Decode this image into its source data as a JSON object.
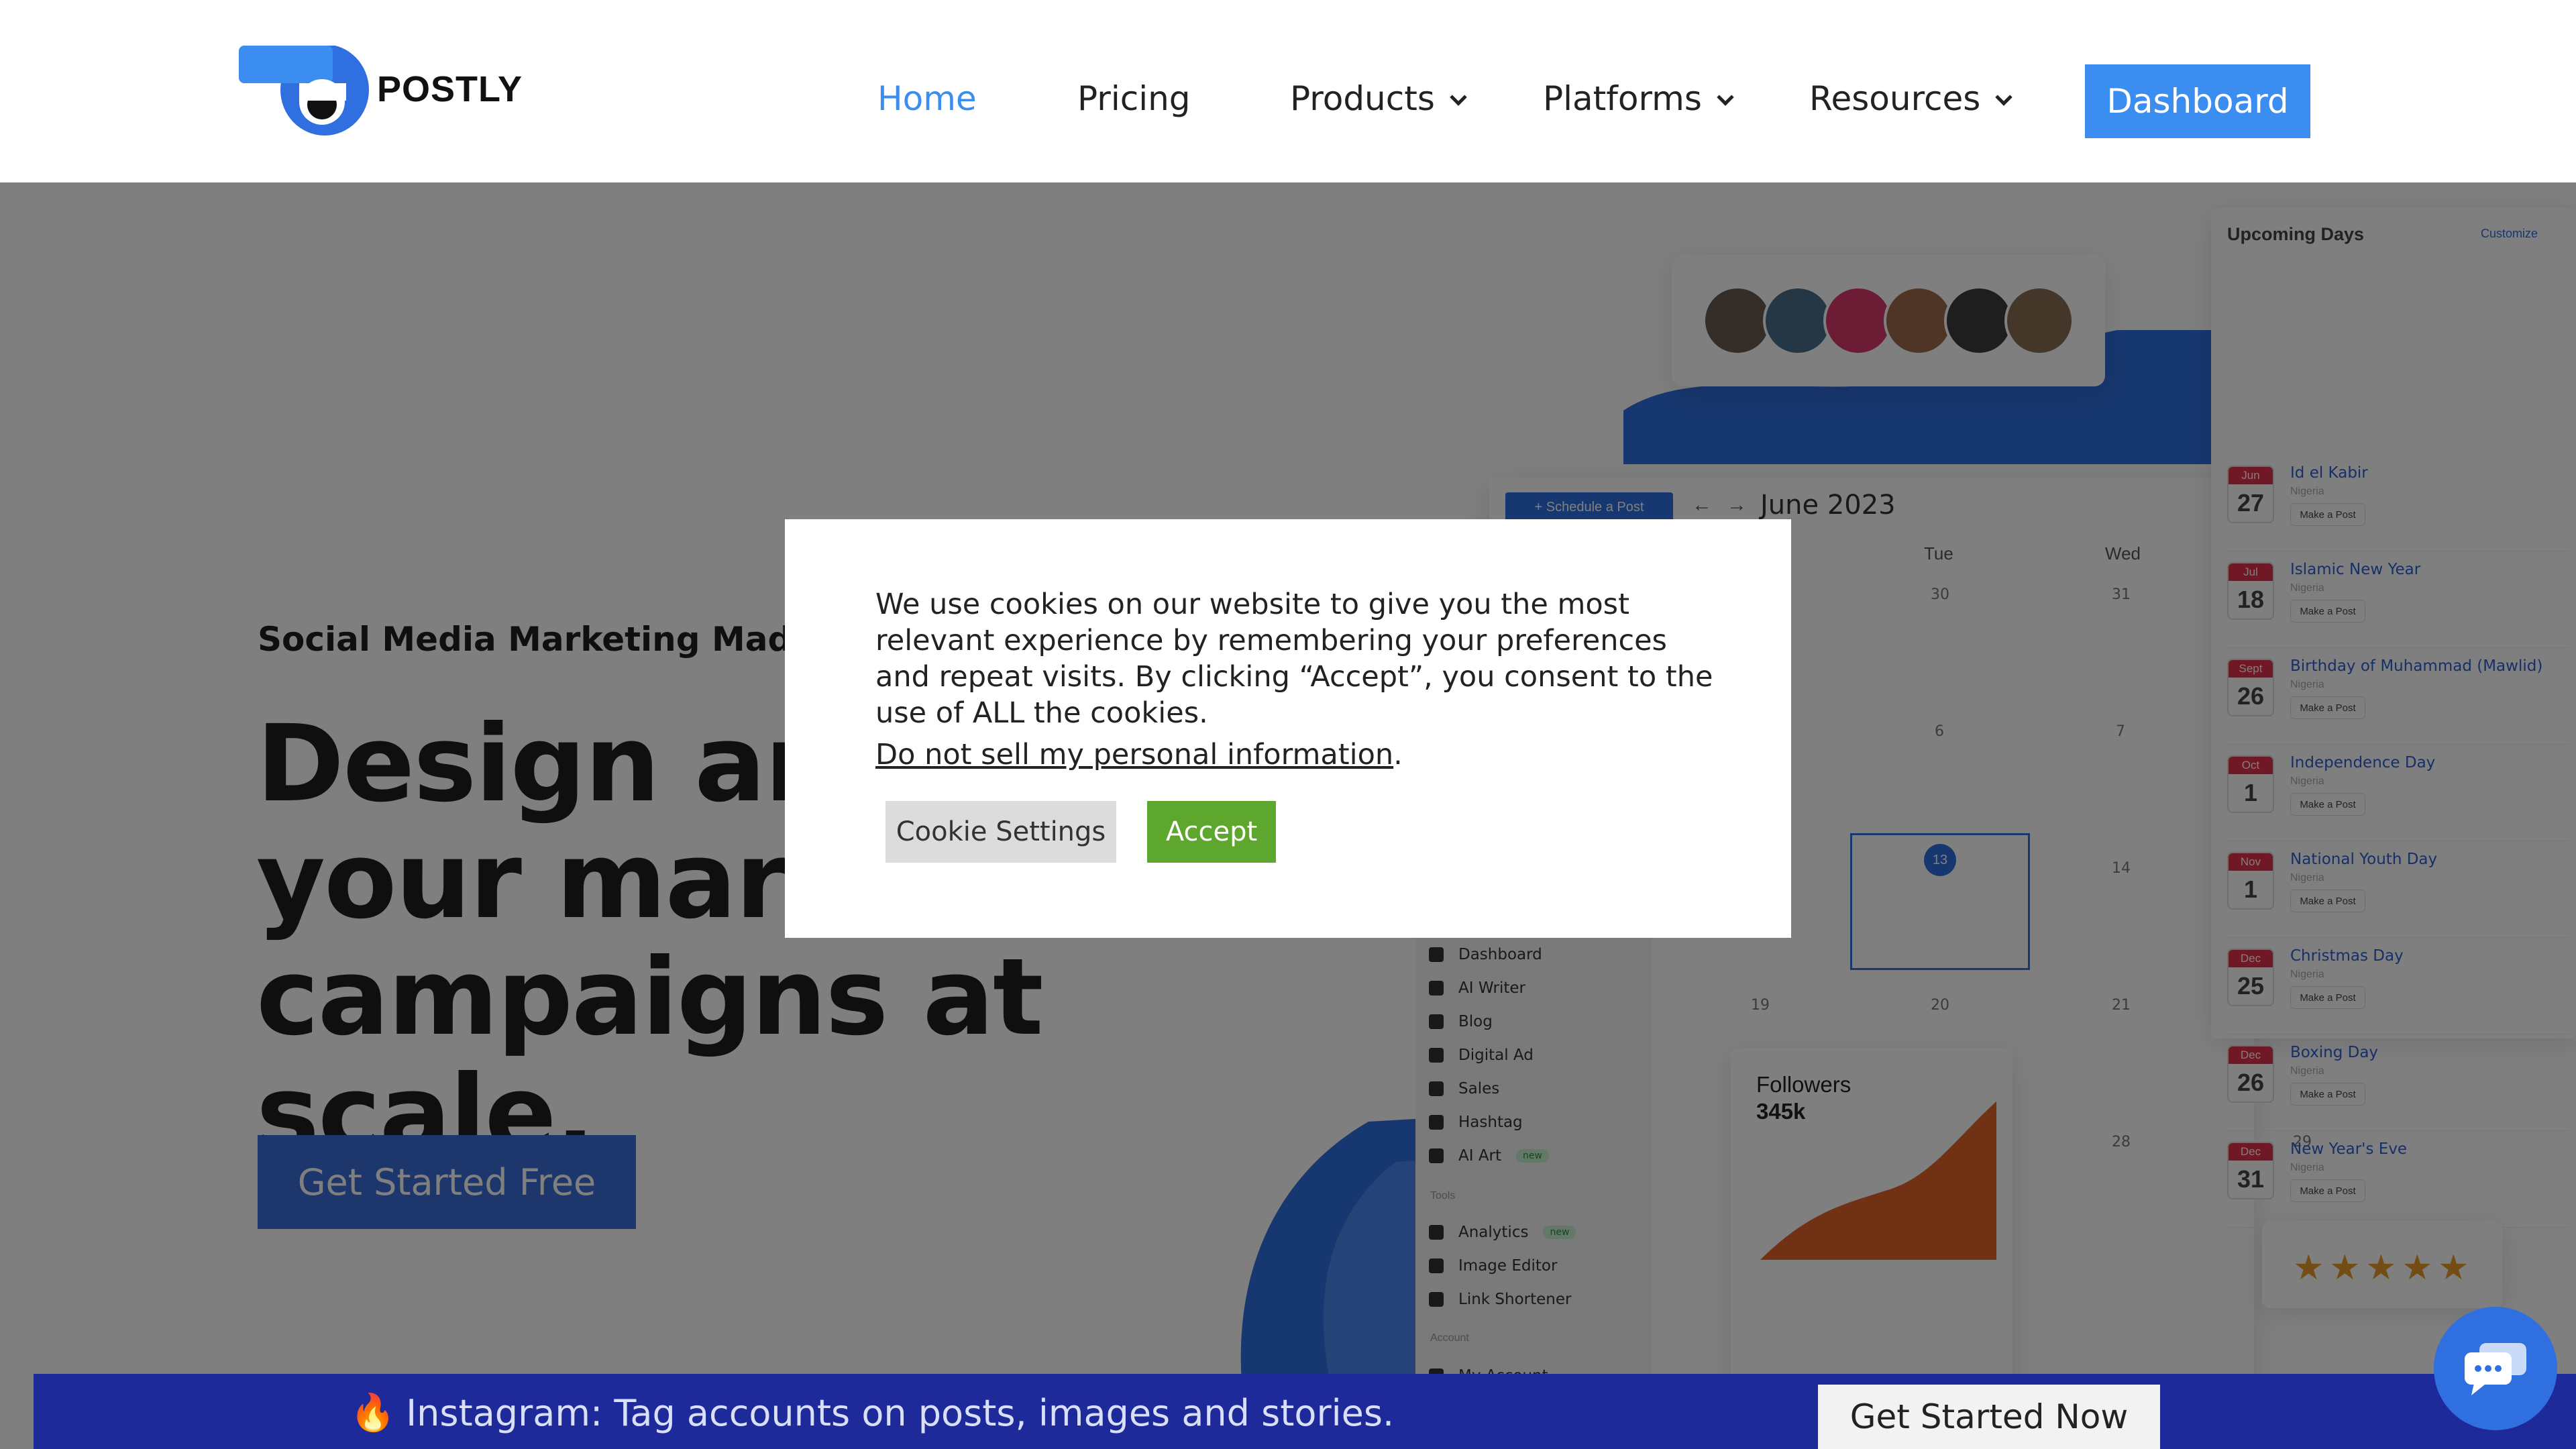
{
  "brand": {
    "name": "POSTLY"
  },
  "nav": {
    "items": [
      {
        "label": "Home",
        "active": true
      },
      {
        "label": "Pricing"
      },
      {
        "label": "Products"
      },
      {
        "label": "Platforms"
      },
      {
        "label": "Resources"
      }
    ],
    "dashboard_label": "Dashboard"
  },
  "hero": {
    "subtitle": "Social Media Marketing Made Ea",
    "title_lines": [
      "Design anc",
      "your marke",
      "campaigns at scale."
    ],
    "cta_label": "Get Started Free"
  },
  "preview": {
    "schedule_label": "+ Schedule a Post",
    "month": "June 2023",
    "weekdays": [
      "Tue",
      "Wed"
    ],
    "followers_label": "Followers",
    "followers_value": "345k",
    "sidebar": [
      {
        "label": "Dashboard"
      },
      {
        "label": "AI Writer"
      },
      {
        "label": "Blog"
      },
      {
        "label": "Digital Ad"
      },
      {
        "label": "Sales"
      },
      {
        "label": "Hashtag"
      },
      {
        "label": "AI Art",
        "badge": "new"
      },
      {
        "label": "Analytics",
        "badge": "new"
      },
      {
        "label": "Image Editor"
      },
      {
        "label": "Link Shortener"
      }
    ],
    "sidebar_sections": {
      "tools": "Tools",
      "account": "Account",
      "my_account": "My Account"
    },
    "upcoming_title": "Upcoming Days",
    "customize_label": "Customize",
    "upcoming": [
      {
        "month": "Jun",
        "day": "27",
        "name": "Id el Kabir",
        "country": "Nigeria"
      },
      {
        "month": "Jul",
        "day": "18",
        "name": "Islamic New Year",
        "country": "Nigeria"
      },
      {
        "month": "Sept",
        "day": "26",
        "name": "Birthday of Muhammad (Mawlid)",
        "country": "Nigeria"
      },
      {
        "month": "Oct",
        "day": "1",
        "name": "Independence Day",
        "country": "Nigeria"
      },
      {
        "month": "Nov",
        "day": "1",
        "name": "National Youth Day",
        "country": "Nigeria"
      },
      {
        "month": "Dec",
        "day": "25",
        "name": "Christmas Day",
        "country": "Nigeria"
      },
      {
        "month": "Dec",
        "day": "26",
        "name": "Boxing Day",
        "country": "Nigeria"
      },
      {
        "month": "Dec",
        "day": "31",
        "name": "New Year's Eve",
        "country": "Nigeria"
      }
    ],
    "make_post_label": "Make a Post",
    "calendar_numbers": [
      "30",
      "31",
      "6",
      "7",
      "13",
      "14",
      "19",
      "20",
      "21",
      "28",
      "29",
      "30"
    ],
    "rating_stars": 5
  },
  "cookie": {
    "text": "We use cookies on our website to give you the most relevant experience by remembering your preferences and repeat visits. By clicking “Accept”, you consent to the use of ALL the cookies.",
    "link": "Do not sell my personal information",
    "link_suffix": ".",
    "settings_label": "Cookie Settings",
    "accept_label": "Accept"
  },
  "notice": {
    "icon": "fire-icon",
    "text": "Instagram: Tag accounts on posts, images and stories.",
    "button_label": "Get Started Now"
  },
  "chat": {
    "icon": "chat-bubble-icon"
  },
  "colors": {
    "brand_blue": "#3b8ef0",
    "cta_blue": "#3b6fd8",
    "accept_green": "#5ea72f",
    "notice_bar": "#1e2a9a"
  }
}
